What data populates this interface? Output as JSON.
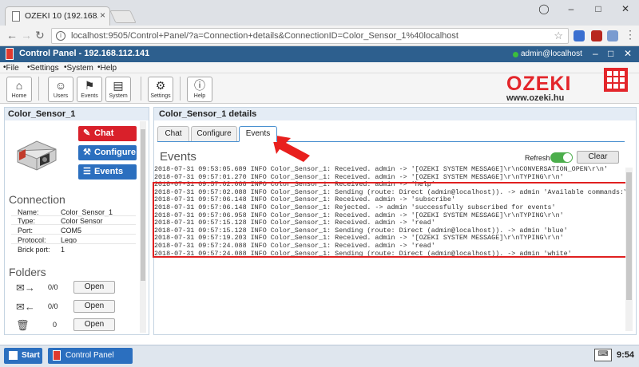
{
  "browser": {
    "tab_title": "OZEKI 10 (192.168.112.14",
    "url": "localhost:9505/Control+Panel/?a=Connection+details&ConnectionID=Color_Sensor_1%40localhost"
  },
  "app": {
    "title": "Control Panel - 192.168.112.141",
    "user": "admin@localhost",
    "menu": [
      "File",
      "Settings",
      "System",
      "Help"
    ],
    "ribbon": [
      {
        "label": "Home",
        "icon": "home-icon"
      },
      {
        "label": "Users",
        "icon": "users-icon"
      },
      {
        "label": "Events",
        "icon": "events-icon"
      },
      {
        "label": "System",
        "icon": "system-icon"
      },
      {
        "label": "Settings",
        "icon": "settings-icon"
      },
      {
        "label": "Help",
        "icon": "help-icon"
      }
    ],
    "logo": {
      "brand": "OZEKI",
      "site": "www.ozeki.hu"
    }
  },
  "left": {
    "title": "Color_Sensor_1",
    "actions": {
      "chat": "Chat",
      "configure": "Configure",
      "events": "Events"
    },
    "connection_heading": "Connection",
    "details": [
      {
        "k": "Name:",
        "v": "Color_Sensor_1"
      },
      {
        "k": "Type:",
        "v": "Color Sensor"
      },
      {
        "k": "Port:",
        "v": "COM5"
      },
      {
        "k": "Protocol:",
        "v": "Lego"
      },
      {
        "k": "Brick port:",
        "v": "1"
      }
    ],
    "folders_heading": "Folders",
    "folders": [
      {
        "icon": "inbox-icon",
        "count": "0/0",
        "button": "Open"
      },
      {
        "icon": "outbox-icon",
        "count": "0/0",
        "button": "Open"
      },
      {
        "icon": "trash-icon",
        "count": "0",
        "button": "Open"
      }
    ]
  },
  "right": {
    "title": "Color_Sensor_1 details",
    "tabs": [
      "Chat",
      "Configure",
      "Events"
    ],
    "active_tab": "Events",
    "events_heading": "Events",
    "refresh_label": "Refresh",
    "refresh_on": true,
    "clear_label": "Clear",
    "log": [
      "2018-07-31 09:53:05.689 INFO Color_Sensor_1: Received. admin -> '[OZEKI SYSTEM MESSAGE]\\r\\nCONVERSATION_OPEN\\r\\n'",
      "2018-07-31 09:57:01.270 INFO Color_Sensor_1: Received. admin -> '[OZEKI SYSTEM MESSAGE]\\r\\nTYPING\\r\\n'",
      "2018-07-31 09:57:02.088 INFO Color_Sensor_1: Received. admin -> 'help'",
      "2018-07-31 09:57:02.088 INFO Color_Sensor_1: Sending (route: Direct (admin@localhost)). -> admin 'Available commands:\\r\\n-",
      "2018-07-31 09:57:06.148 INFO Color_Sensor_1: Received. admin -> 'subscribe'",
      "2018-07-31 09:57:06.148 INFO Color_Sensor_1: Rejected. -> admin 'successfully subscribed for events'",
      "2018-07-31 09:57:06.958 INFO Color_Sensor_1: Received. admin -> '[OZEKI SYSTEM MESSAGE]\\r\\nTYPING\\r\\n'",
      "2018-07-31 09:57:15.128 INFO Color_Sensor_1: Received. admin -> 'read'",
      "2018-07-31 09:57:15.128 INFO Color_Sensor_1: Sending (route: Direct (admin@localhost)). -> admin 'blue'",
      "2018-07-31 09:57:19.203 INFO Color_Sensor_1: Received. admin -> '[OZEKI SYSTEM MESSAGE]\\r\\nTYPING\\r\\n'",
      "2018-07-31 09:57:24.088 INFO Color_Sensor_1: Received. admin -> 'read'",
      "2018-07-31 09:57:24.088 INFO Color_Sensor_1: Sending (route: Direct (admin@localhost)). -> admin 'white'"
    ]
  },
  "taskbar": {
    "start": "Start",
    "app": "Control Panel",
    "time": "9:54"
  },
  "colors": {
    "header": "#2d5f8e",
    "chat_button": "#d9202a",
    "action_button": "#2b6fbf",
    "highlight_box": "#e02020",
    "logo": "#e3262b"
  }
}
